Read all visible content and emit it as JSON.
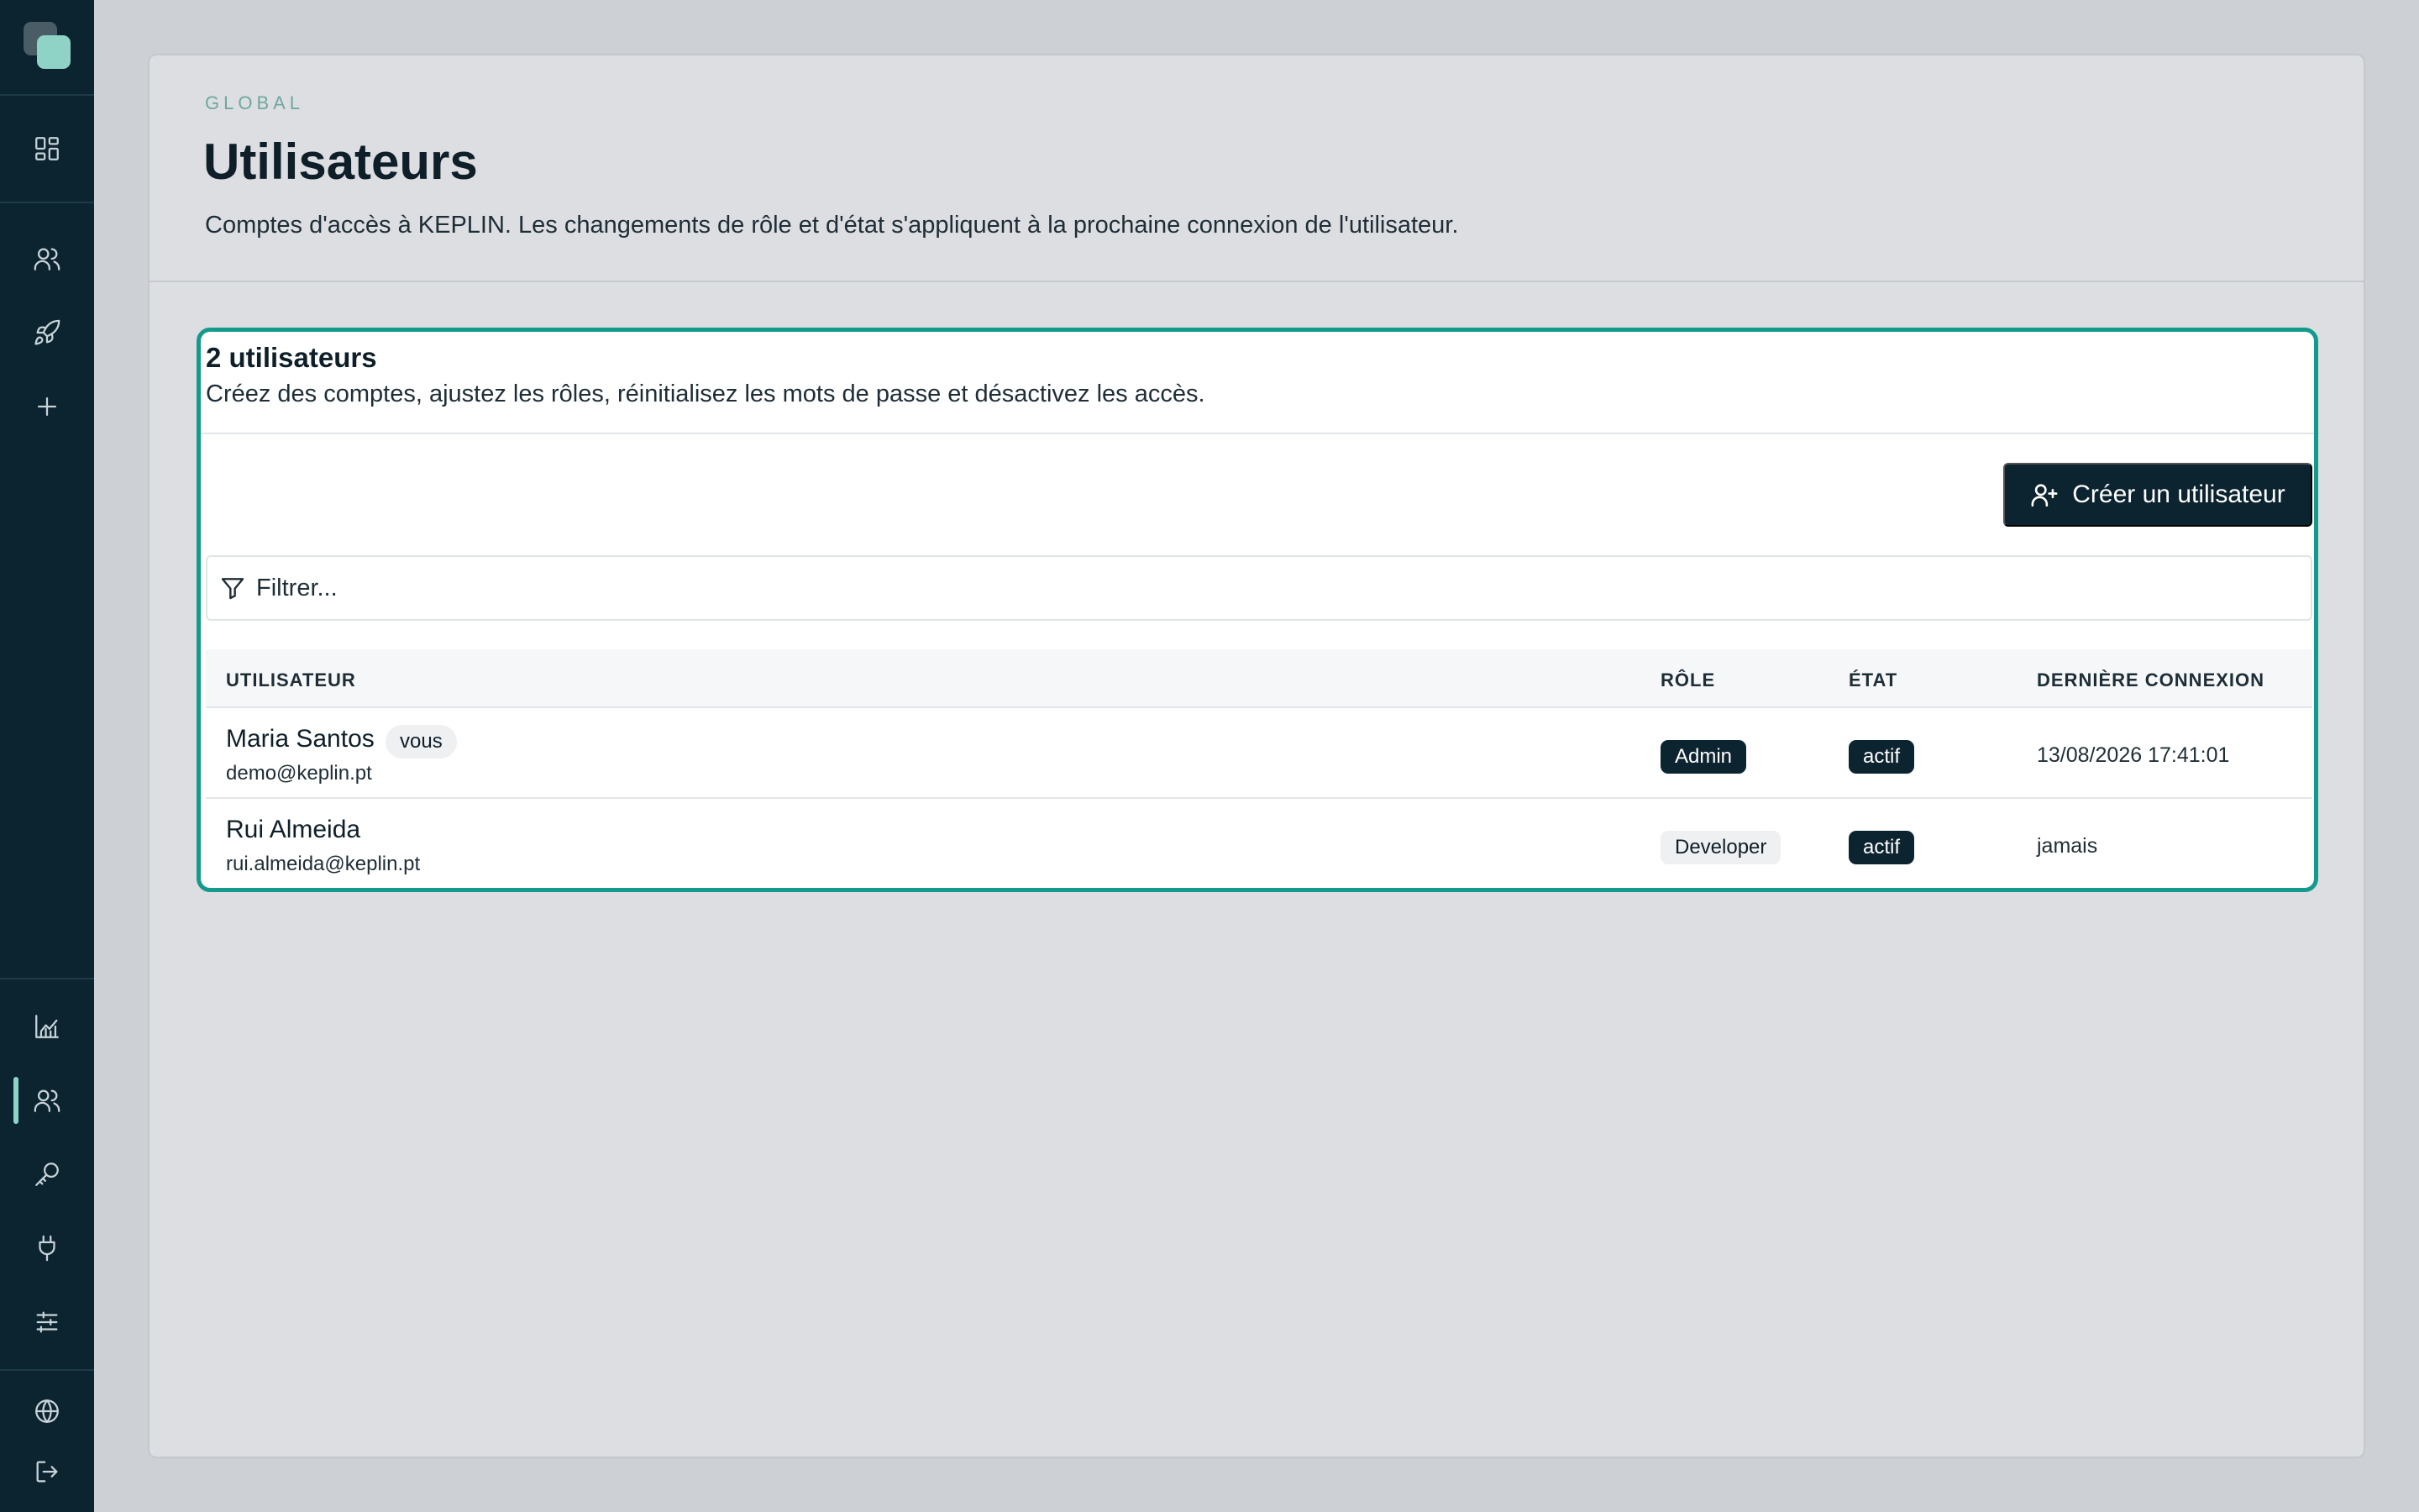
{
  "page": {
    "eyebrow": "GLOBAL",
    "title": "Utilisateurs",
    "description": "Comptes d'accès à KEPLIN. Les changements de rôle et d'état s'appliquent à la prochaine connexion de l'utilisateur."
  },
  "sidebar": {
    "top_icons": [
      "dashboard-icon",
      "users-icon",
      "rocket-icon",
      "plus-icon"
    ],
    "bottom_icons": [
      "analytics-icon",
      "users-icon",
      "key-icon",
      "plug-icon",
      "sliders-icon"
    ],
    "footer_icons": [
      "globe-icon",
      "logout-icon"
    ],
    "active_item": "users-icon",
    "accent_color": "#8fd3c7"
  },
  "panel": {
    "count_label": "2 utilisateurs",
    "subtitle": "Créez des comptes, ajustez les rôles, réinitialisez les mots de passe et désactivez les accès.",
    "create_button": "Créer un utilisateur",
    "filter_placeholder": "Filtrer...",
    "accent_color": "#149a8c"
  },
  "table": {
    "columns": [
      "UTILISATEUR",
      "RÔLE",
      "ÉTAT",
      "DERNIÈRE CONNEXION"
    ],
    "rows": [
      {
        "name": "Maria Santos",
        "email": "demo@keplin.pt",
        "you_badge": "vous",
        "role": "Admin",
        "state": "actif",
        "last_login": "13/08/2026 17:41:01"
      },
      {
        "name": "Rui Almeida",
        "email": "rui.almeida@keplin.pt",
        "you_badge": "",
        "role": "Developer",
        "state": "actif",
        "last_login": "jamais"
      }
    ]
  }
}
